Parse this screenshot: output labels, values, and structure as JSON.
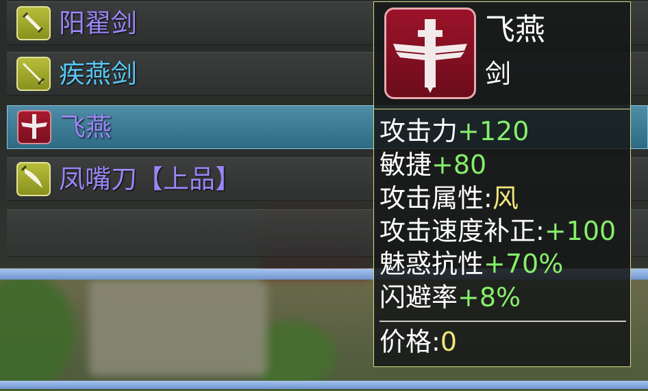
{
  "colors": {
    "purple_text": "#9b85f4",
    "blue_text": "#59c6f2",
    "green_value": "#86ef6a",
    "yellow_value": "#f2e77a",
    "border_gold": "#d7dc84",
    "selected_row": "#3e7f99"
  },
  "item_list": [
    {
      "name": "阳翟剑",
      "icon": "sword-icon",
      "color": "#9b85f4",
      "selected": false
    },
    {
      "name": "疾燕剑",
      "icon": "sword-icon",
      "color": "#59c6f2",
      "selected": false
    },
    {
      "name": "飞燕",
      "icon": "winged-sword-icon",
      "color": "#9b85f4",
      "selected": true
    },
    {
      "name": "凤嘴刀【上品】",
      "icon": "blade-icon",
      "color": "#9b85f4",
      "selected": false
    }
  ],
  "detail": {
    "name": "飞燕",
    "type": "剑",
    "icon": "winged-sword-icon",
    "stats": [
      {
        "label": "攻击力",
        "value": "+120"
      },
      {
        "label": "敏捷",
        "value": "+80"
      },
      {
        "label": "攻击属性:",
        "value": "风"
      },
      {
        "label": "攻击速度补正:",
        "value": "+100"
      },
      {
        "label": "魅惑抗性",
        "value": "+70%"
      },
      {
        "label": "闪避率",
        "value": "+8%"
      }
    ],
    "price_label": "价格:",
    "price_value": "0"
  }
}
